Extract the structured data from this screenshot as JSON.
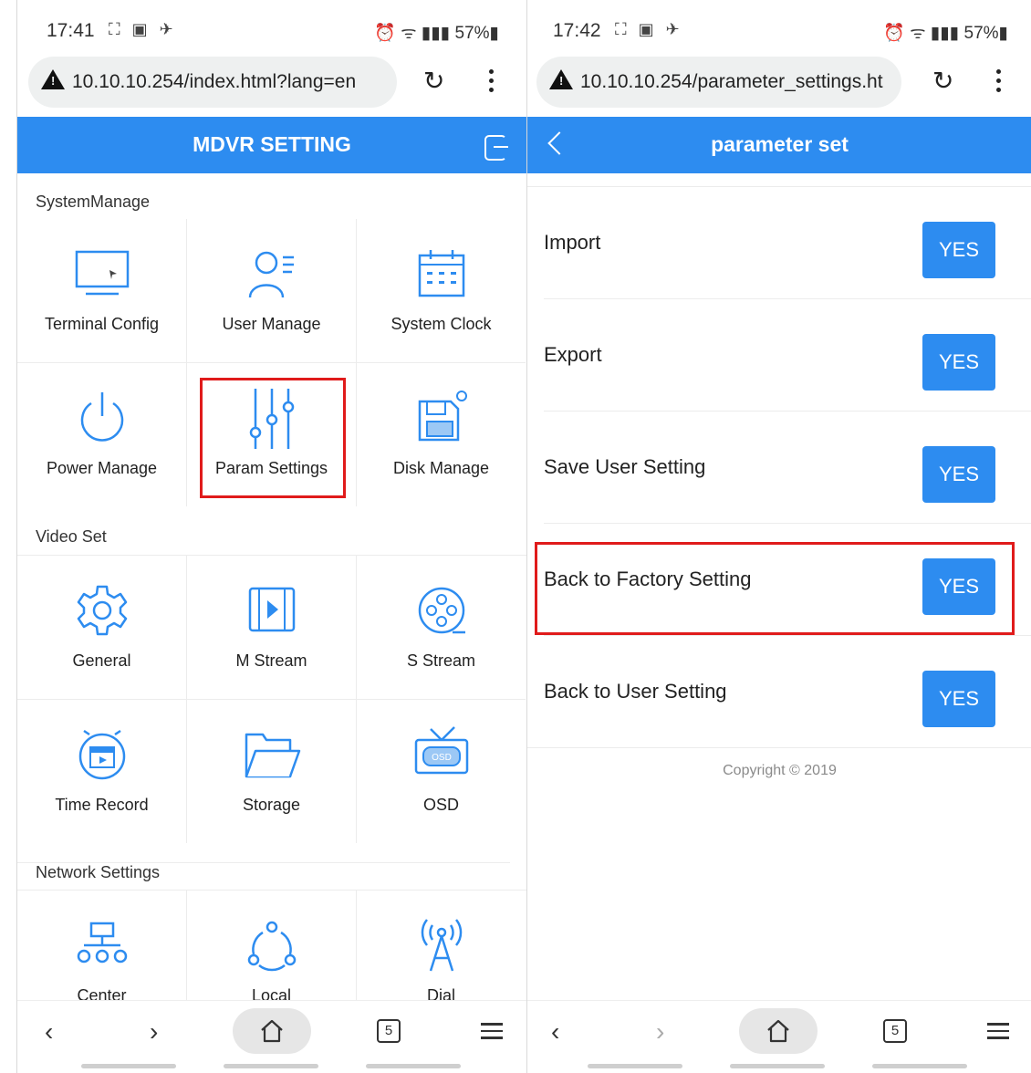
{
  "left": {
    "status": {
      "time": "17:41",
      "time_icons": "⛶ ▣ ✈",
      "right_icons": "⏰ ᯤ ▮▮▮ 57%▮"
    },
    "browser": {
      "url": "10.10.10.254/index.html?lang=en"
    },
    "appbar": {
      "title": "MDVR SETTING"
    },
    "sections": [
      {
        "title": "SystemManage",
        "items": [
          {
            "label": "Terminal Config",
            "icon": "monitor-icon"
          },
          {
            "label": "User Manage",
            "icon": "user-list-icon"
          },
          {
            "label": "System Clock",
            "icon": "calendar-icon"
          },
          {
            "label": "Power Manage",
            "icon": "power-icon"
          },
          {
            "label": "Param Settings",
            "icon": "sliders-icon"
          },
          {
            "label": "Disk Manage",
            "icon": "floppy-gear-icon"
          }
        ]
      },
      {
        "title": "Video Set",
        "items": [
          {
            "label": "General",
            "icon": "gear-icon"
          },
          {
            "label": "M Stream",
            "icon": "film-icon"
          },
          {
            "label": "S Stream",
            "icon": "film-reel-icon"
          },
          {
            "label": "Time Record",
            "icon": "clapper-clock-icon"
          },
          {
            "label": "Storage",
            "icon": "folder-icon"
          },
          {
            "label": "OSD",
            "icon": "tv-osd-icon"
          }
        ]
      },
      {
        "title": "Network Settings",
        "items": [
          {
            "label": "Center",
            "icon": "network-tree-icon"
          },
          {
            "label": "Local",
            "icon": "share-nodes-icon"
          },
          {
            "label": "Dial",
            "icon": "antenna-icon"
          }
        ]
      }
    ],
    "nav": {
      "tab_count": "5"
    }
  },
  "right": {
    "status": {
      "time": "17:42",
      "time_icons": "⛶ ▣ ✈",
      "right_icons": "⏰ ᯤ ▮▮▮ 57%▮"
    },
    "browser": {
      "url": "10.10.10.254/parameter_settings.ht"
    },
    "appbar": {
      "title": "parameter set"
    },
    "rows": [
      {
        "label": "Import",
        "button": "YES"
      },
      {
        "label": "Export",
        "button": "YES"
      },
      {
        "label": "Save User Setting",
        "button": "YES"
      },
      {
        "label": "Back to Factory Setting",
        "button": "YES"
      },
      {
        "label": "Back to User Setting",
        "button": "YES"
      }
    ],
    "copyright": "Copyright © 2019",
    "nav": {
      "tab_count": "5"
    }
  },
  "colors": {
    "accent": "#2d8cf0",
    "highlight": "#e01b1b"
  }
}
